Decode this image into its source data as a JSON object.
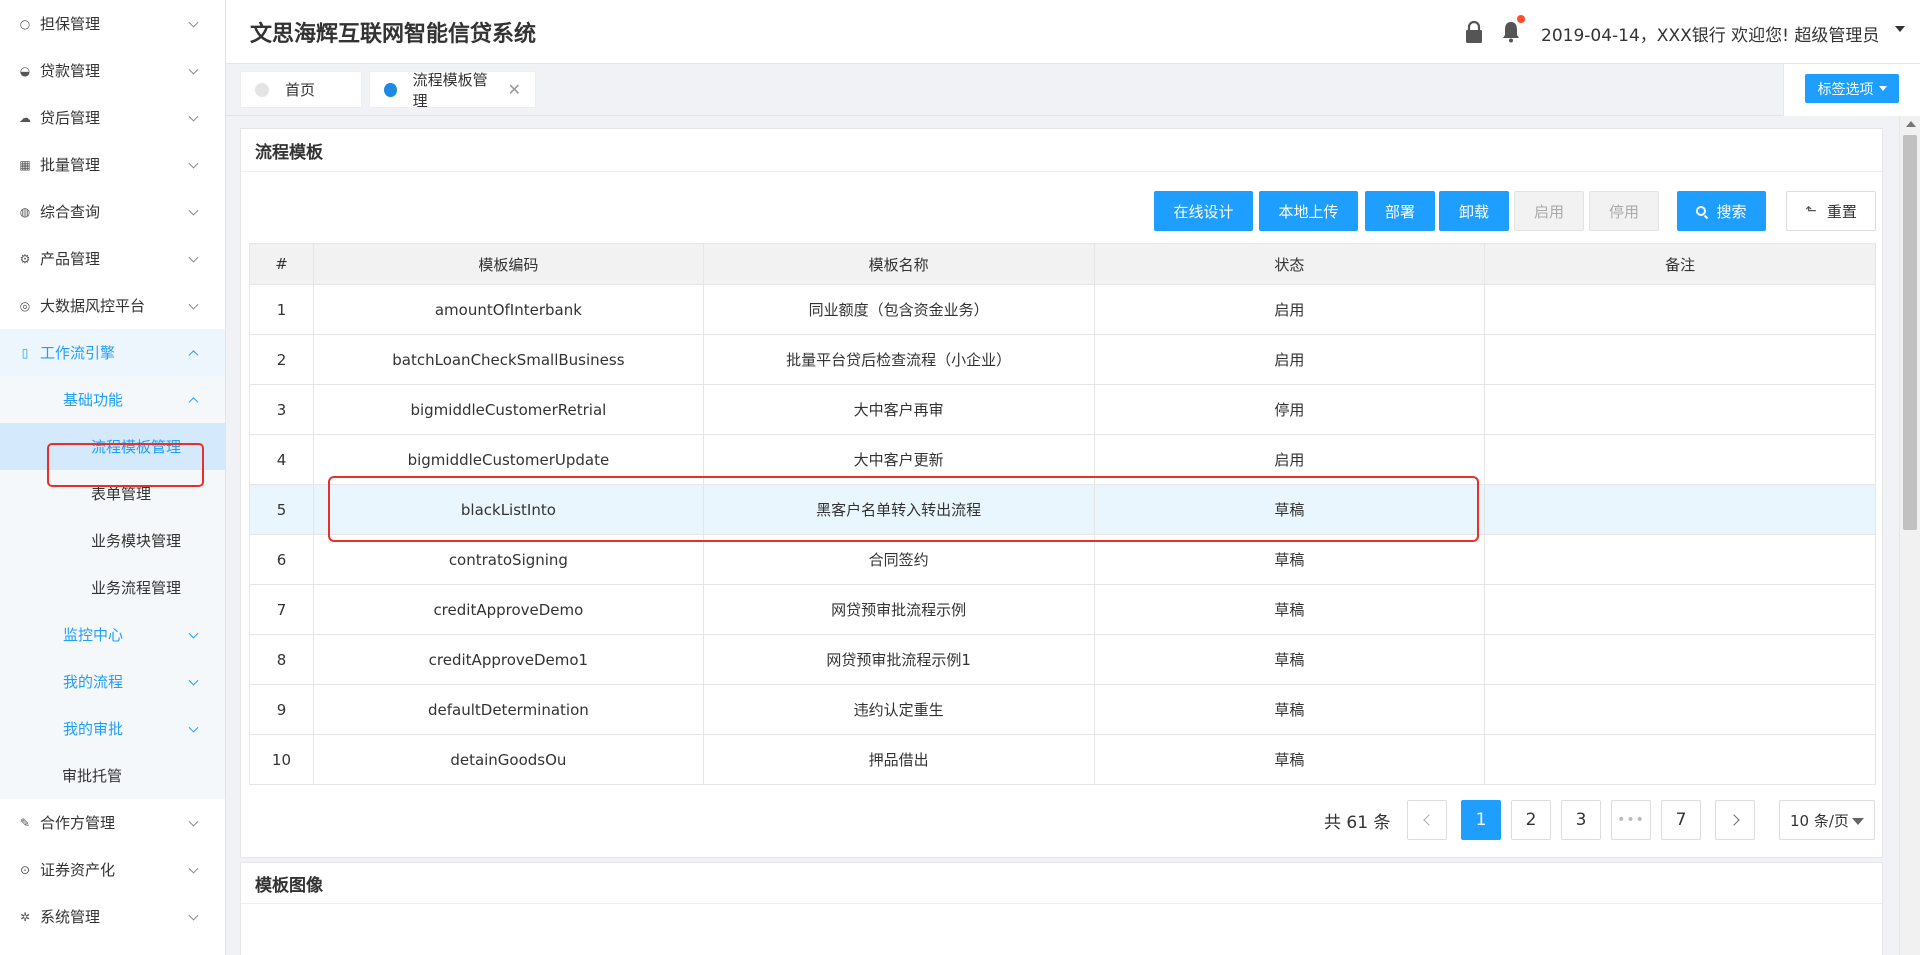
{
  "app": {
    "title": "文思海辉互联网智能信贷系统",
    "header_info": "2019-04-14，XXX银行  欢迎您! 超级管理员"
  },
  "sidebar": {
    "items": [
      {
        "label": "担保管理",
        "icon": "circle-outline-icon"
      },
      {
        "label": "贷款管理",
        "icon": "pie-icon"
      },
      {
        "label": "贷后管理",
        "icon": "cloud-icon"
      },
      {
        "label": "批量管理",
        "icon": "grid-icon"
      },
      {
        "label": "综合查询",
        "icon": "globe-icon"
      },
      {
        "label": "产品管理",
        "icon": "gear-icon"
      },
      {
        "label": "大数据风控平台",
        "icon": "signal-icon"
      },
      {
        "label": "工作流引擎",
        "icon": "phone-icon"
      }
    ],
    "workflow_sub": {
      "basic": "基础功能",
      "basic_items": [
        "流程模板管理",
        "表单管理",
        "业务模块管理",
        "业务流程管理"
      ],
      "monitor": "监控中心",
      "my_flow": "我的流程",
      "my_approval": "我的审批",
      "trustee": "审批托管"
    },
    "items_after": [
      {
        "label": "合作方管理",
        "icon": "pencil-icon"
      },
      {
        "label": "证券资产化",
        "icon": "circle-dot-icon"
      },
      {
        "label": "系统管理",
        "icon": "cog-icon"
      }
    ]
  },
  "tabs": {
    "home": "首页",
    "current": "流程模板管理",
    "options": "标签选项"
  },
  "panel": {
    "title": "流程模板",
    "buttons": {
      "design": "在线设计",
      "upload": "本地上传",
      "deploy": "部署",
      "unload": "卸载",
      "enable": "启用",
      "disable": "停用",
      "search": "搜索",
      "reset": "重置"
    }
  },
  "table": {
    "headers": [
      "#",
      "模板编码",
      "模板名称",
      "状态",
      "备注"
    ],
    "rows": [
      [
        "1",
        "amountOfInterbank",
        "同业额度（包含资金业务）",
        "启用",
        ""
      ],
      [
        "2",
        "batchLoanCheckSmallBusiness",
        "批量平台贷后检查流程（小企业）",
        "启用",
        ""
      ],
      [
        "3",
        "bigmiddleCustomerRetrial",
        "大中客户再审",
        "停用",
        ""
      ],
      [
        "4",
        "bigmiddleCustomerUpdate",
        "大中客户更新",
        "启用",
        ""
      ],
      [
        "5",
        "blackListInto",
        "黑客户名单转入转出流程",
        "草稿",
        ""
      ],
      [
        "6",
        "contratoSigning",
        "合同签约",
        "草稿",
        ""
      ],
      [
        "7",
        "creditApproveDemo",
        "网贷预审批流程示例",
        "草稿",
        ""
      ],
      [
        "8",
        "creditApproveDemo1",
        "网贷预审批流程示例1",
        "草稿",
        ""
      ],
      [
        "9",
        "defaultDetermination",
        "违约认定重生",
        "草稿",
        ""
      ],
      [
        "10",
        "detainGoodsOu",
        "押品借出",
        "草稿",
        ""
      ]
    ]
  },
  "pager": {
    "total": "共 61 条",
    "pages": [
      "1",
      "2",
      "3",
      "•••",
      "7"
    ],
    "current": "1",
    "size": "10 条/页"
  },
  "panel2": {
    "title": "模板图像"
  },
  "colors": {
    "accent": "#1e9fff",
    "highlight_box": "#e8302a"
  }
}
